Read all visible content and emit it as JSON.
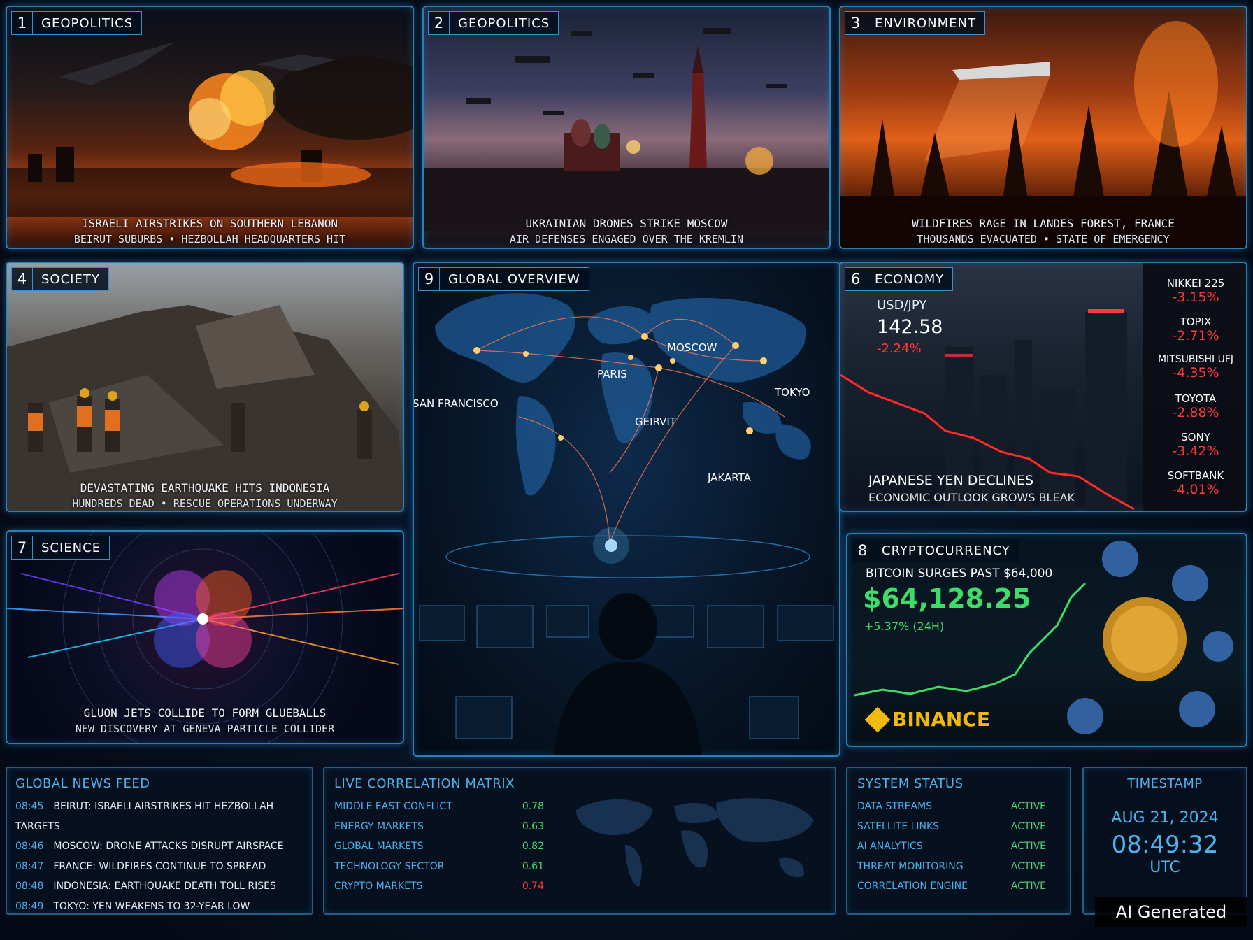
{
  "panels": {
    "p1": {
      "num": "1",
      "label": "GEOPOLITICS",
      "line1": "ISRAELI AIRSTRIKES ON SOUTHERN LEBANON",
      "line2": "BEIRUT SUBURBS • HEZBOLLAH HEADQUARTERS HIT"
    },
    "p2": {
      "num": "2",
      "label": "GEOPOLITICS",
      "line1": "UKRAINIAN DRONES STRIKE MOSCOW",
      "line2": "AIR DEFENSES ENGAGED OVER THE KREMLIN"
    },
    "p3": {
      "num": "3",
      "label": "ENVIRONMENT",
      "line1": "WILDFIRES RAGE IN LANDES FOREST, FRANCE",
      "line2": "THOUSANDS EVACUATED • STATE OF EMERGENCY"
    },
    "p4": {
      "num": "4",
      "label": "SOCIETY",
      "line1": "DEVASTATING EARTHQUAKE HITS INDONESIA",
      "line2": "HUNDREDS DEAD • RESCUE OPERATIONS UNDERWAY"
    },
    "p6": {
      "num": "6",
      "label": "ECONOMY",
      "pair": "USD/JPY",
      "rate": "142.58",
      "change": "-2.24%",
      "headline": "JAPANESE YEN DECLINES",
      "subline": "ECONOMIC OUTLOOK GROWS BLEAK",
      "tickers": [
        {
          "name": "NIKKEI 225",
          "value": "-3.15%"
        },
        {
          "name": "TOPIX",
          "value": "-2.71%"
        },
        {
          "name": "MITSUBISHI UFJ",
          "value": "-4.35%"
        },
        {
          "name": "TOYOTA",
          "value": "-2.88%"
        },
        {
          "name": "SONY",
          "value": "-3.42%"
        },
        {
          "name": "SOFTBANK",
          "value": "-4.01%"
        }
      ]
    },
    "p7": {
      "num": "7",
      "label": "SCIENCE",
      "line1": "GLUON JETS COLLIDE TO FORM GLUEBALLS",
      "line2": "NEW DISCOVERY AT GENEVA PARTICLE COLLIDER"
    },
    "p8": {
      "num": "8",
      "label": "CRYPTOCURRENCY",
      "headline": "BITCOIN SURGES PAST $64,000",
      "price": "$64,128.25",
      "change": "+5.37% (24H)",
      "brand": "BINANCE"
    },
    "p9": {
      "num": "9",
      "label": "GLOBAL OVERVIEW",
      "cities": {
        "sf": "SAN FRANCISCO",
        "paris": "PARIS",
        "moscow": "MOSCOW",
        "beirut": "GEIRVIT",
        "tokyo": "TOKYO",
        "jakarta": "JAKARTA"
      }
    }
  },
  "news_feed": {
    "title": "GLOBAL NEWS FEED",
    "items": [
      {
        "time": "08:45",
        "text": "BEIRUT: ISRAELI AIRSTRIKES HIT HEZBOLLAH TARGETS"
      },
      {
        "time": "08:46",
        "text": "MOSCOW: DRONE ATTACKS DISRUPT AIRSPACE"
      },
      {
        "time": "08:47",
        "text": "FRANCE: WILDFIRES CONTINUE TO SPREAD"
      },
      {
        "time": "08:48",
        "text": "INDONESIA: EARTHQUAKE DEATH TOLL RISES"
      },
      {
        "time": "08:49",
        "text": "TOKYO: YEN WEAKENS TO 32-YEAR LOW"
      }
    ]
  },
  "correlation": {
    "title": "LIVE CORRELATION MATRIX",
    "rows": [
      {
        "label": "MIDDLE EAST CONFLICT",
        "value": "0.78"
      },
      {
        "label": "ENERGY MARKETS",
        "value": "0.63"
      },
      {
        "label": "GLOBAL MARKETS",
        "value": "0.82"
      },
      {
        "label": "TECHNOLOGY SECTOR",
        "value": "0.61"
      },
      {
        "label": "CRYPTO MARKETS",
        "value": "0.74"
      }
    ]
  },
  "system_status": {
    "title": "SYSTEM STATUS",
    "rows": [
      {
        "label": "DATA STREAMS",
        "status": "ACTIVE"
      },
      {
        "label": "SATELLITE LINKS",
        "status": "ACTIVE"
      },
      {
        "label": "AI ANALYTICS",
        "status": "ACTIVE"
      },
      {
        "label": "THREAT MONITORING",
        "status": "ACTIVE"
      },
      {
        "label": "CORRELATION ENGINE",
        "status": "ACTIVE"
      }
    ]
  },
  "timestamp": {
    "title": "TIMESTAMP",
    "date": "AUG 21, 2024",
    "time": "08:49:32",
    "zone": "UTC"
  },
  "watermark": "AI Generated",
  "colors": {
    "accent": "#4fb0ea",
    "panel_border": "#2a7fb8",
    "negative": "#ff3a3a",
    "positive": "#3fdc6a",
    "status_active": "#4fd07a"
  }
}
